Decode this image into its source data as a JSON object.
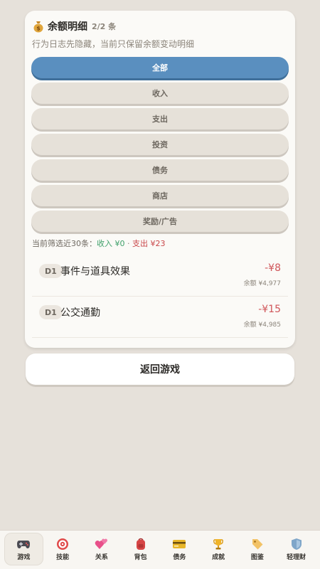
{
  "card": {
    "title": "余额明细",
    "count": "2/2 条",
    "subtitle": "行为日志先隐藏，当前只保留余额变动明细",
    "filters": [
      {
        "label": "全部",
        "active": true
      },
      {
        "label": "收入",
        "active": false
      },
      {
        "label": "支出",
        "active": false
      },
      {
        "label": "投资",
        "active": false
      },
      {
        "label": "债务",
        "active": false
      },
      {
        "label": "商店",
        "active": false
      },
      {
        "label": "奖励/广告",
        "active": false
      }
    ],
    "summary": {
      "prefix": "当前筛选近30条：",
      "income": "收入 ¥0",
      "separator": " · ",
      "expense": "支出 ¥23"
    },
    "entries": [
      {
        "day": "D1",
        "description": "事件与道具效果",
        "amount": "-¥8",
        "balance": "余额 ¥4,977"
      },
      {
        "day": "D1",
        "description": "公交通勤",
        "amount": "-¥15",
        "balance": "余额 ¥4,985"
      }
    ]
  },
  "back_button": "返回游戏",
  "tabs": [
    {
      "label": "游戏",
      "icon": "gamepad-icon",
      "active": true
    },
    {
      "label": "技能",
      "icon": "target-icon",
      "active": false
    },
    {
      "label": "关系",
      "icon": "hearts-icon",
      "active": false
    },
    {
      "label": "背包",
      "icon": "backpack-icon",
      "active": false
    },
    {
      "label": "债务",
      "icon": "credit-card-icon",
      "active": false
    },
    {
      "label": "成就",
      "icon": "trophy-icon",
      "active": false
    },
    {
      "label": "图鉴",
      "icon": "tag-icon",
      "active": false
    },
    {
      "label": "轻理财",
      "icon": "shield-icon",
      "active": false
    }
  ],
  "colors": {
    "accent": "#5a8fbf",
    "income": "#3fa06a",
    "expense": "#d0565a",
    "background": "#e6e1da"
  }
}
